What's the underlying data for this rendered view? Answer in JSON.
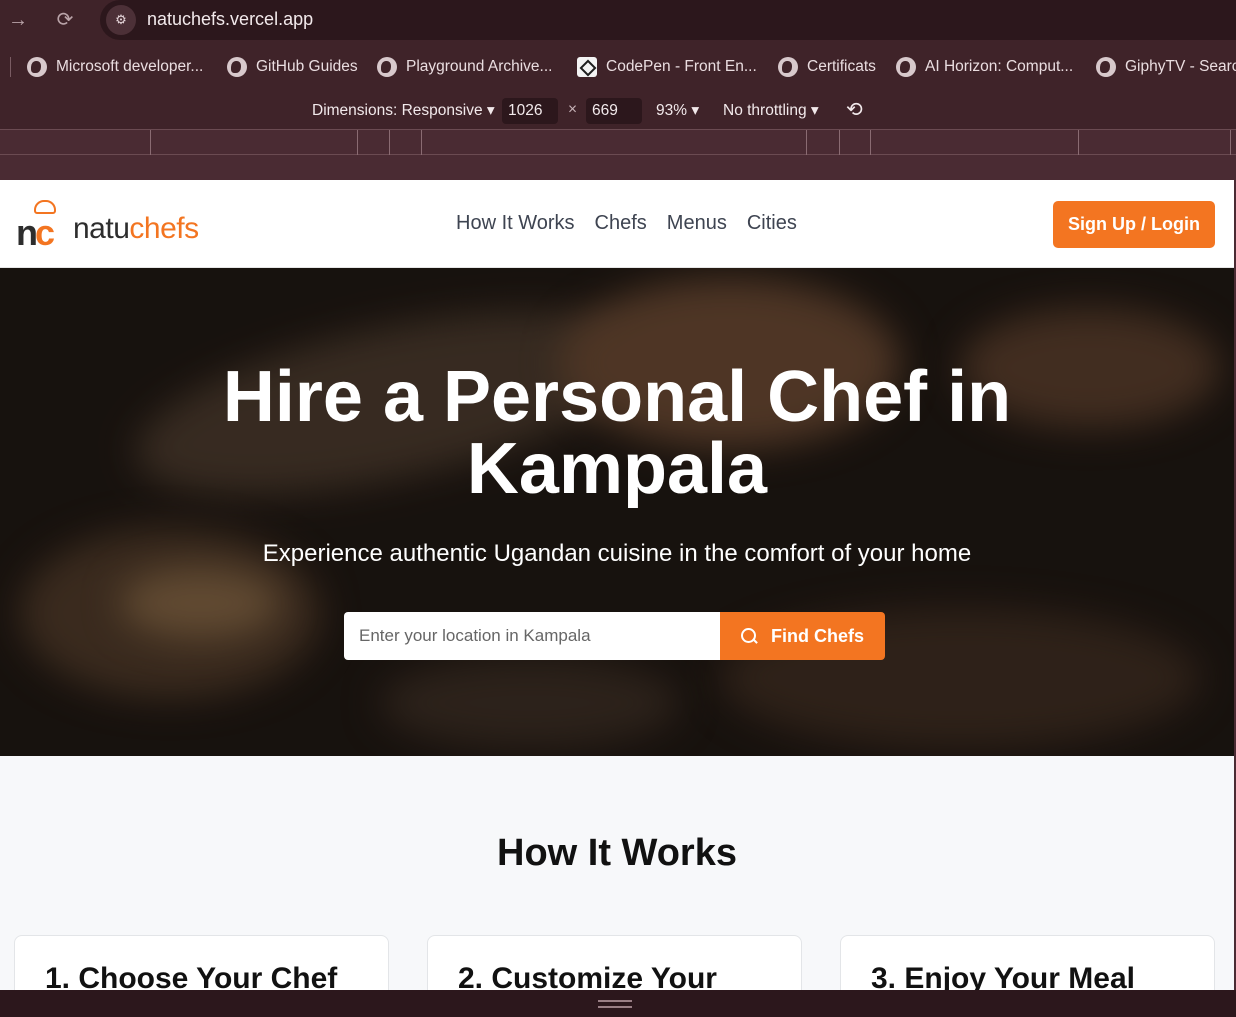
{
  "browser": {
    "url": "natuchefs.vercel.app",
    "bookmarks": [
      "Microsoft developer...",
      "GitHub Guides",
      "Playground Archive...",
      "CodePen - Front En...",
      "Certificats",
      "AI Horizon: Comput...",
      "GiphyTV - Searc"
    ]
  },
  "devtools": {
    "dimensions_label": "Dimensions: Responsive",
    "width": "1026",
    "times": "×",
    "height": "669",
    "zoom": "93%",
    "throttling": "No throttling"
  },
  "site": {
    "logo_text": "natuchefs",
    "logo_mark": "nc",
    "nav": [
      "How It Works",
      "Chefs",
      "Menus",
      "Cities"
    ],
    "signup_label": "Sign Up / Login",
    "hero_title_line1": "Hire a Personal Chef in",
    "hero_title_line2": "Kampala",
    "hero_subtitle": "Experience authentic Ugandan cuisine in the comfort of your home",
    "search_placeholder": "Enter your location in Kampala",
    "find_button": "Find Chefs",
    "section_title": "How It Works",
    "cards": [
      "1. Choose Your Chef",
      "2. Customize Your",
      "3. Enjoy Your Meal"
    ]
  },
  "colors": {
    "brand_orange": "#f37521",
    "browser_chrome": "#3f2329"
  }
}
